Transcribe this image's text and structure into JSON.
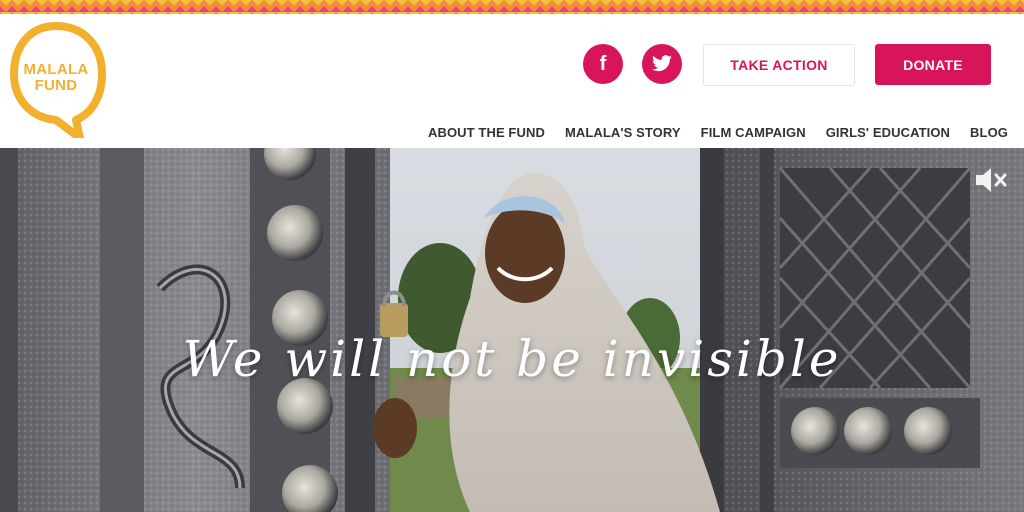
{
  "brand": {
    "logo_line1": "MALALA",
    "logo_line2": "FUND",
    "primary_color": "#d8145a",
    "logo_color": "#f3b02c"
  },
  "social": {
    "facebook_glyph": "f",
    "twitter_glyph": "🐦"
  },
  "header": {
    "take_action_label": "TAKE ACTION",
    "donate_label": "DONATE"
  },
  "nav": {
    "items": [
      {
        "label": "ABOUT THE FUND"
      },
      {
        "label": "MALALA'S STORY"
      },
      {
        "label": "FILM CAMPAIGN"
      },
      {
        "label": "GIRLS' EDUCATION"
      },
      {
        "label": "BLOG"
      }
    ]
  },
  "hero": {
    "tagline": "We will not be invisible",
    "mute_icon": "speaker-muted-icon"
  }
}
